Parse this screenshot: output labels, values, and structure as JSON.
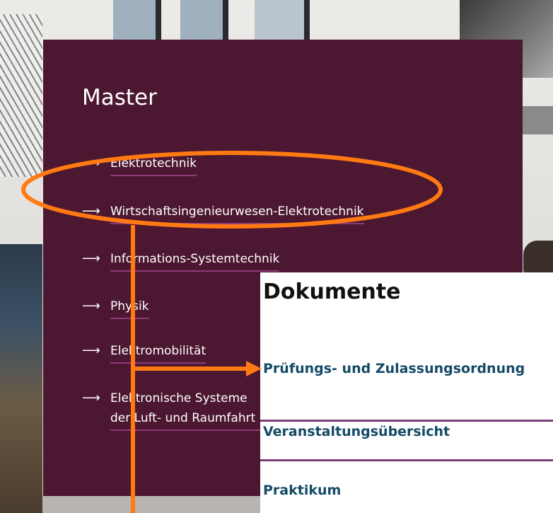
{
  "master": {
    "title": "Master",
    "links": [
      {
        "arrow": "⟶",
        "label": "Elektrotechnik"
      },
      {
        "arrow": "⟶",
        "label": "Wirtschaftsingenieurwesen-Elektrotechnik"
      },
      {
        "arrow": "⟶",
        "label": "Informations-Systemtechnik"
      },
      {
        "arrow": "⟶",
        "label": "Physik"
      },
      {
        "arrow": "⟶",
        "label": "Elektromobilität"
      },
      {
        "arrow": "⟶",
        "label": "Elektronische Systeme der Luft- und Raumfahrt"
      }
    ]
  },
  "documents": {
    "title": "Dokumente",
    "links": [
      {
        "label": "Prüfungs- und Zulassungsordnung"
      },
      {
        "label": "Veranstaltungsübersicht"
      },
      {
        "label": "Praktikum"
      }
    ]
  },
  "colors": {
    "panel": "#4c1731",
    "underline": "#8e3a7a",
    "doc_link": "#144a66",
    "annotation": "#ff7a12"
  }
}
